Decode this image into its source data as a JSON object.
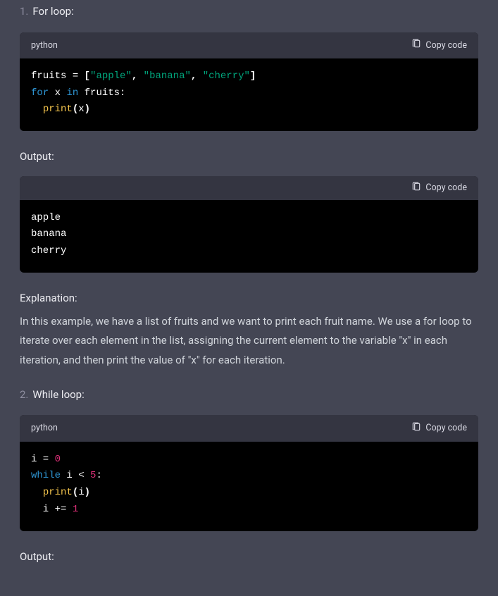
{
  "copy_label": "Copy code",
  "output_label": "Output:",
  "explanation_label": "Explanation:",
  "item1": {
    "number": "1.",
    "title": "For loop:",
    "code_lang": "python",
    "code": {
      "l1_var": "fruits",
      "l1_assign": " = ",
      "l1_open": "[",
      "l1_s1": "\"apple\"",
      "l1_c1": ", ",
      "l1_s2": "\"banana\"",
      "l1_c2": ", ",
      "l1_s3": "\"cherry\"",
      "l1_close": "]",
      "l2_for": "for",
      "l2_x": " x ",
      "l2_in": "in",
      "l2_fruits": " fruits:",
      "l3_print": "print",
      "l3_open": "(",
      "l3_arg": "x",
      "l3_close": ")"
    },
    "output": "apple\nbanana\ncherry",
    "explanation": "In this example, we have a list of fruits and we want to print each fruit name. We use a for loop to iterate over each element in the list, assigning the current element to the variable \"x\" in each iteration, and then print the value of \"x\" for each iteration."
  },
  "item2": {
    "number": "2.",
    "title": "While loop:",
    "code_lang": "python",
    "code": {
      "l1_var": "i",
      "l1_assign": " = ",
      "l1_val": "0",
      "l2_while": "while",
      "l2_cond": " i < ",
      "l2_five": "5",
      "l2_colon": ":",
      "l3_print": "print",
      "l3_open": "(",
      "l3_arg": "i",
      "l3_close": ")",
      "l4_inc": "  i += ",
      "l4_one": "1"
    }
  }
}
